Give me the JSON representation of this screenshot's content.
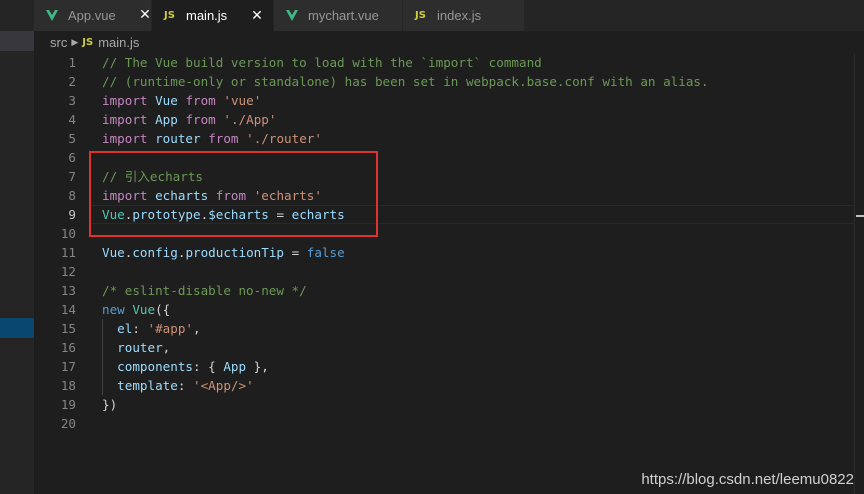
{
  "tabs": [
    {
      "label": "App.vue",
      "icon": "vue-icon",
      "active": false
    },
    {
      "label": "main.js",
      "icon": "js-icon",
      "active": true
    },
    {
      "label": "mychart.vue",
      "icon": "vue-icon",
      "active": false
    },
    {
      "label": "index.js",
      "icon": "js-icon",
      "active": false
    }
  ],
  "js_badge": "JS",
  "close_glyph": "✕",
  "breadcrumb": {
    "folder": "src",
    "file": "main.js"
  },
  "current_line": 9,
  "code_lines": [
    {
      "n": 1,
      "tokens": [
        {
          "t": "// The Vue build version to load with the `import` command",
          "c": "comment"
        }
      ]
    },
    {
      "n": 2,
      "tokens": [
        {
          "t": "// (runtime-only or standalone) has been set in webpack.base.conf with an alias.",
          "c": "comment"
        }
      ]
    },
    {
      "n": 3,
      "tokens": [
        {
          "t": "import",
          "c": "ctrl"
        },
        {
          "t": " ",
          "c": "pl"
        },
        {
          "t": "Vue",
          "c": "var"
        },
        {
          "t": " ",
          "c": "pl"
        },
        {
          "t": "from",
          "c": "ctrl"
        },
        {
          "t": " ",
          "c": "pl"
        },
        {
          "t": "'vue'",
          "c": "str"
        }
      ]
    },
    {
      "n": 4,
      "tokens": [
        {
          "t": "import",
          "c": "ctrl"
        },
        {
          "t": " ",
          "c": "pl"
        },
        {
          "t": "App",
          "c": "var"
        },
        {
          "t": " ",
          "c": "pl"
        },
        {
          "t": "from",
          "c": "ctrl"
        },
        {
          "t": " ",
          "c": "pl"
        },
        {
          "t": "'./App'",
          "c": "str"
        }
      ]
    },
    {
      "n": 5,
      "tokens": [
        {
          "t": "import",
          "c": "ctrl"
        },
        {
          "t": " ",
          "c": "pl"
        },
        {
          "t": "router",
          "c": "var"
        },
        {
          "t": " ",
          "c": "pl"
        },
        {
          "t": "from",
          "c": "ctrl"
        },
        {
          "t": " ",
          "c": "pl"
        },
        {
          "t": "'./router'",
          "c": "str"
        }
      ]
    },
    {
      "n": 6,
      "tokens": []
    },
    {
      "n": 7,
      "tokens": [
        {
          "t": "// 引入echarts",
          "c": "comment"
        }
      ]
    },
    {
      "n": 8,
      "tokens": [
        {
          "t": "import",
          "c": "ctrl"
        },
        {
          "t": " ",
          "c": "pl"
        },
        {
          "t": "echarts",
          "c": "var"
        },
        {
          "t": " ",
          "c": "pl"
        },
        {
          "t": "from",
          "c": "ctrl"
        },
        {
          "t": " ",
          "c": "pl"
        },
        {
          "t": "'echarts'",
          "c": "str"
        }
      ]
    },
    {
      "n": 9,
      "tokens": [
        {
          "t": "Vue",
          "c": "cls"
        },
        {
          "t": ".",
          "c": "pl"
        },
        {
          "t": "prototype",
          "c": "var"
        },
        {
          "t": ".",
          "c": "pl"
        },
        {
          "t": "$echarts",
          "c": "var"
        },
        {
          "t": " = ",
          "c": "pl"
        },
        {
          "t": "echarts",
          "c": "var"
        }
      ]
    },
    {
      "n": 10,
      "tokens": []
    },
    {
      "n": 11,
      "tokens": [
        {
          "t": "Vue",
          "c": "var"
        },
        {
          "t": ".",
          "c": "pl"
        },
        {
          "t": "config",
          "c": "var"
        },
        {
          "t": ".",
          "c": "pl"
        },
        {
          "t": "productionTip",
          "c": "var"
        },
        {
          "t": " = ",
          "c": "pl"
        },
        {
          "t": "false",
          "c": "kw"
        }
      ]
    },
    {
      "n": 12,
      "tokens": []
    },
    {
      "n": 13,
      "tokens": [
        {
          "t": "/* eslint-disable no-new */",
          "c": "comment"
        }
      ]
    },
    {
      "n": 14,
      "tokens": [
        {
          "t": "new",
          "c": "kw"
        },
        {
          "t": " ",
          "c": "pl"
        },
        {
          "t": "Vue",
          "c": "cls"
        },
        {
          "t": "({",
          "c": "pl"
        }
      ]
    },
    {
      "n": 15,
      "tokens": [
        {
          "t": "  ",
          "c": "pl"
        },
        {
          "t": "el",
          "c": "var"
        },
        {
          "t": ": ",
          "c": "pl"
        },
        {
          "t": "'#app'",
          "c": "str"
        },
        {
          "t": ",",
          "c": "pl"
        }
      ]
    },
    {
      "n": 16,
      "tokens": [
        {
          "t": "  ",
          "c": "pl"
        },
        {
          "t": "router",
          "c": "var"
        },
        {
          "t": ",",
          "c": "pl"
        }
      ]
    },
    {
      "n": 17,
      "tokens": [
        {
          "t": "  ",
          "c": "pl"
        },
        {
          "t": "components",
          "c": "var"
        },
        {
          "t": ": { ",
          "c": "pl"
        },
        {
          "t": "App",
          "c": "var"
        },
        {
          "t": " },",
          "c": "pl"
        }
      ]
    },
    {
      "n": 18,
      "tokens": [
        {
          "t": "  ",
          "c": "pl"
        },
        {
          "t": "template",
          "c": "var"
        },
        {
          "t": ": ",
          "c": "pl"
        },
        {
          "t": "'<App/>'",
          "c": "str"
        }
      ]
    },
    {
      "n": 19,
      "tokens": [
        {
          "t": "})",
          "c": "pl"
        }
      ]
    },
    {
      "n": 20,
      "tokens": []
    }
  ],
  "watermark": "https://blog.csdn.net/leemu0822",
  "colors": {
    "editor_bg": "#1e1e1e",
    "highlight_box": "#e03131",
    "sidebar_selected": "#094771",
    "comment": "#6a9955",
    "string": "#ce9178",
    "keyword": "#569cd6",
    "control": "#c586c0",
    "variable": "#9cdcfe",
    "class": "#4ec9b0"
  }
}
